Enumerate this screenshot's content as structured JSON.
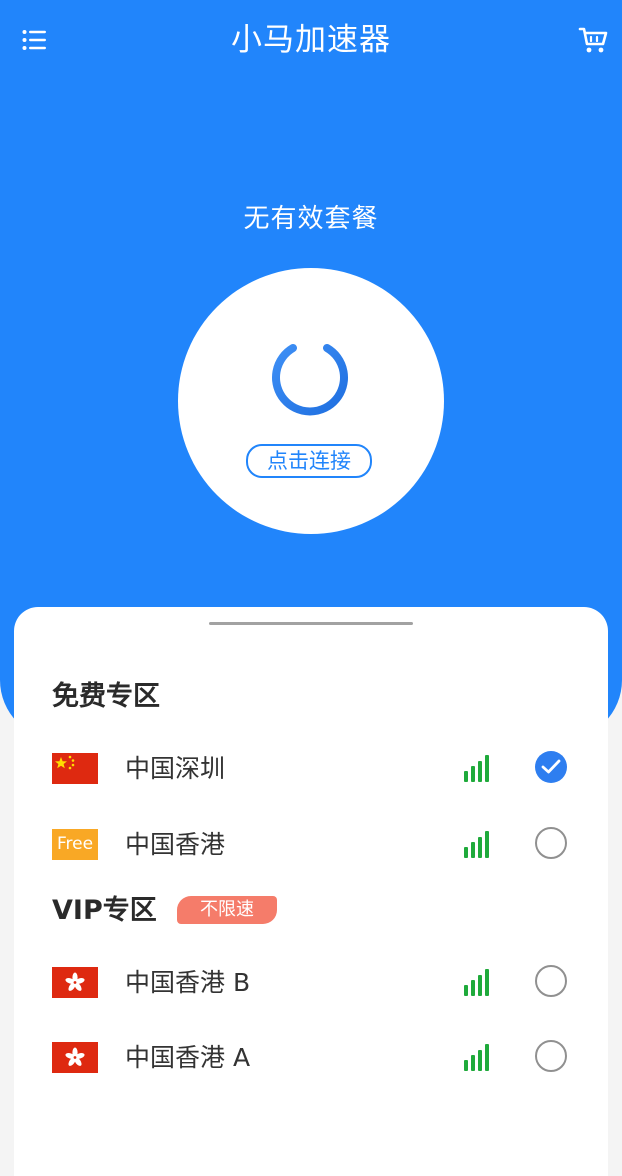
{
  "header": {
    "menu_icon": "menu-icon",
    "title": "小马加速器",
    "cart_icon": "cart-icon"
  },
  "status": {
    "plan_text": "无有效套餐"
  },
  "connect": {
    "power_icon": "power-icon",
    "button_label": "点击连接"
  },
  "sections": {
    "free": {
      "title": "免费专区"
    },
    "vip": {
      "title": "VIP专区",
      "badge": "不限速"
    }
  },
  "servers": [
    {
      "name": "中国深圳",
      "flag": "china-flag-icon",
      "signal": "signal-strength-icon",
      "selected": true
    },
    {
      "name": "中国香港",
      "flag": "free-badge-icon",
      "flag_text": "Free",
      "signal": "signal-strength-icon",
      "selected": false
    },
    {
      "name": "中国香港 B",
      "flag": "hong-kong-flag-icon",
      "signal": "signal-strength-icon",
      "selected": false
    },
    {
      "name": "中国香港 A",
      "flag": "hong-kong-flag-icon",
      "signal": "signal-strength-icon",
      "selected": false
    }
  ],
  "colors": {
    "primary": "#2185fb",
    "signal": "#1faa3b",
    "badge": "#f57c6a",
    "free_flag": "#f9a825",
    "flag_red": "#de2910",
    "check": "#2e7ef0"
  }
}
